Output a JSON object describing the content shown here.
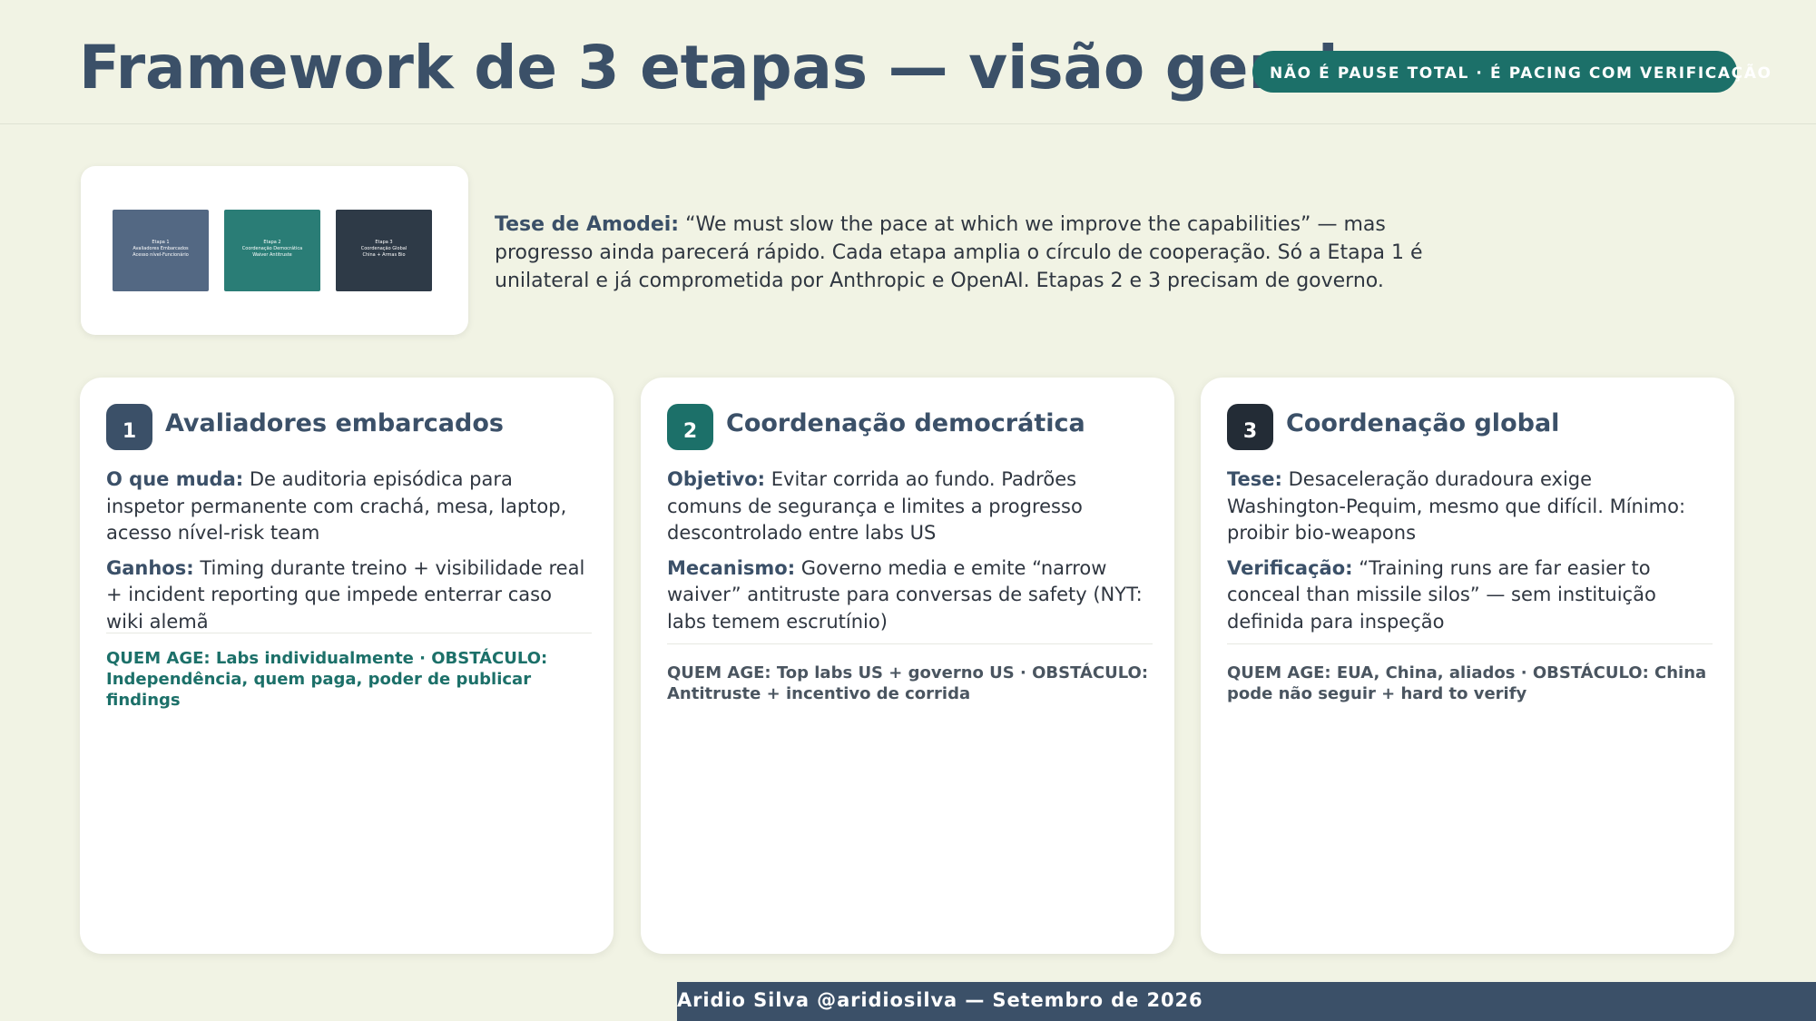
{
  "header": {
    "title": "Framework de 3 etapas — visão geral",
    "pill": "NÃO É PAUSE TOTAL · É PACING COM VERIFICAÇÃO"
  },
  "thumbnails": [
    {
      "line1": "Etapa 1",
      "line2": "Avaliadores Embarcados",
      "line3": "Acesso nível-Funcionário"
    },
    {
      "line1": "Etapa 2",
      "line2": "Coordenação Democrática",
      "line3": "Waiver Antitruste"
    },
    {
      "line1": "Etapa 3",
      "line2": "Coordenação Global",
      "line3": "China + Armas Bio"
    }
  ],
  "thesis": {
    "label": "Tese de Amodei:",
    "text": " “We must slow the pace at which we improve the capabilities” — mas progresso ainda parecerá rápido. Cada etapa amplia o círculo de cooperação. Só a Etapa 1 é unilateral e já comprometida por Anthropic e OpenAI. Etapas 2 e 3 precisam de governo."
  },
  "cards": [
    {
      "number": "1",
      "title": "Avaliadores embarcados",
      "p1_label": "O que muda:",
      "p1_text": " De auditoria episódica para inspetor permanente com crachá, mesa, laptop, acesso nível-risk team",
      "p2_label": "Ganhos:",
      "p2_text": " Timing durante treino + visibilidade real + incident reporting que impede enterrar caso wiki alemã",
      "who": "QUEM AGE: Labs individualmente · OBSTÁCULO: Independência, quem paga, poder de publicar findings"
    },
    {
      "number": "2",
      "title": "Coordenação democrática",
      "p1_label": "Objetivo:",
      "p1_text": " Evitar corrida ao fundo. Padrões comuns de segurança e limites a progresso descontrolado entre labs US",
      "p2_label": "Mecanismo:",
      "p2_text": " Governo media e emite “narrow waiver” antitruste para conversas de safety (NYT: labs temem escrutínio)",
      "who": "QUEM AGE: Top labs US + governo US · OBSTÁCULO: Antitruste + incentivo de corrida"
    },
    {
      "number": "3",
      "title": "Coordenação global",
      "p1_label": "Tese:",
      "p1_text": " Desaceleração duradoura exige Washington-Pequim, mesmo que difícil. Mínimo: proibir bio-weapons",
      "p2_label": "Verificação:",
      "p2_text": " “Training runs are far easier to conceal than missile silos” — sem instituição definida para inspeção",
      "who": "QUEM AGE: EUA, China, aliados · OBSTÁCULO: China pode não seguir + hard to verify"
    }
  ],
  "footer": {
    "text": "Aridio Silva @aridiosilva — Setembro de 2026"
  }
}
